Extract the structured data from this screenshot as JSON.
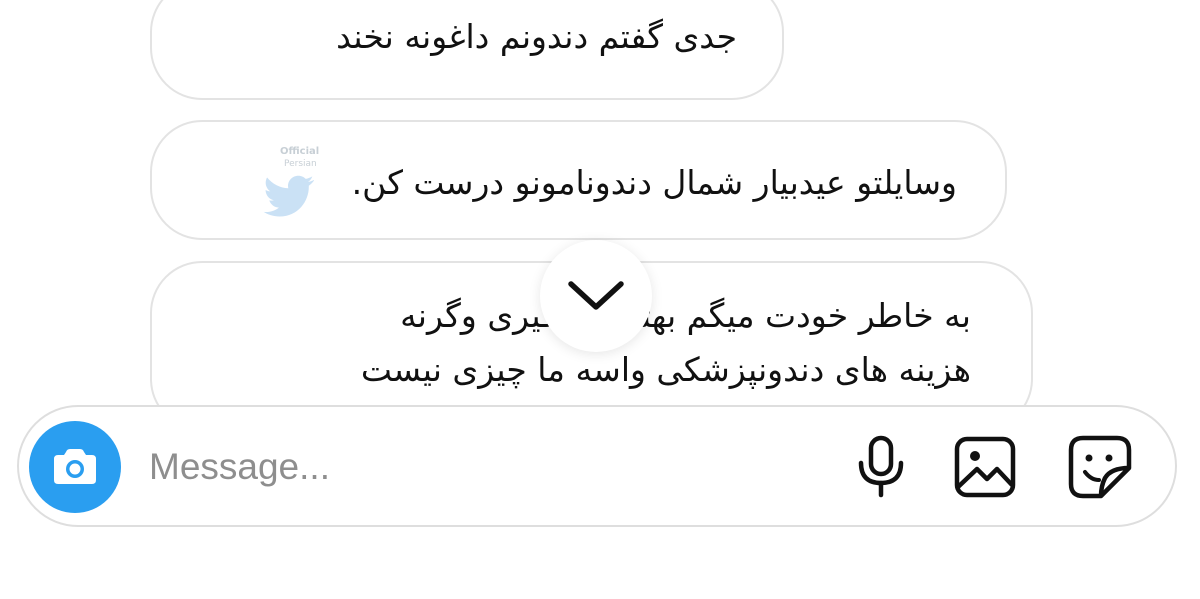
{
  "messages": [
    {
      "lines": [
        "جدی گفتم دندونم داغونه نخند"
      ]
    },
    {
      "lines": [
        "وسایلتو عیدبیار شمال دندونامونو درست کن."
      ]
    },
    {
      "lines": [
        "به خاطر خودت میگم بهتر یاد بگیری وگرنه",
        "هزینه های دندونپزشکی واسه ما چیزی نیست"
      ]
    }
  ],
  "watermark": {
    "line1": "Official",
    "line2": "Persian"
  },
  "composer": {
    "placeholder": "Message...",
    "camera_icon": "camera-icon",
    "mic_icon": "microphone-icon",
    "gallery_icon": "image-icon",
    "sticker_icon": "sticker-icon"
  },
  "colors": {
    "accent": "#2a9ef0",
    "bubble_border": "#e3e3e3",
    "placeholder": "#8e8e8e"
  }
}
